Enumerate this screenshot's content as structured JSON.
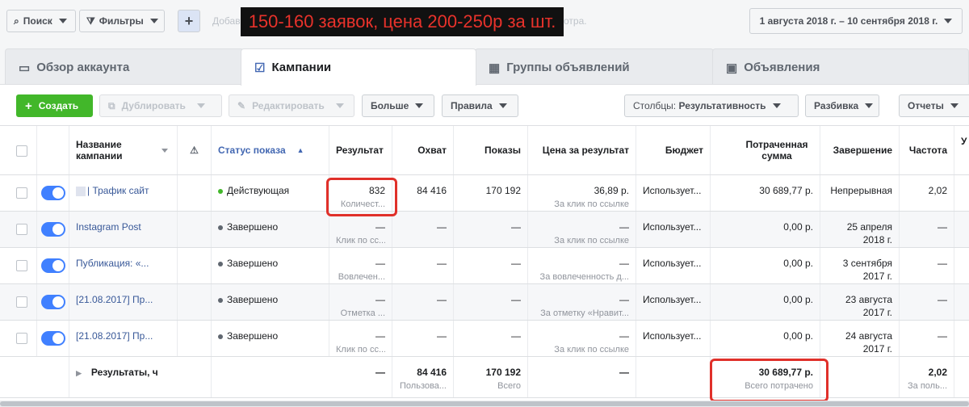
{
  "topbar": {
    "search_label": "Поиск",
    "filters_label": "Фильтры",
    "add_hint_left": "Добав",
    "add_hint_right": "отра.",
    "date_range": "1 августа 2018 г. – 10 сентября 2018 г."
  },
  "banner": "150-160 заявок, цена 200-250р за шт.",
  "tabs": [
    {
      "label": "Обзор аккаунта",
      "icon": "account-overview-icon"
    },
    {
      "label": "Кампании",
      "icon": "campaigns-icon"
    },
    {
      "label": "Группы объявлений",
      "icon": "ad-sets-icon"
    },
    {
      "label": "Объявления",
      "icon": "ads-icon"
    }
  ],
  "toolbar": {
    "create": "Создать",
    "duplicate": "Дублировать",
    "edit": "Редактировать",
    "more": "Больше",
    "rules": "Правила",
    "columns_prefix": "Столбцы: ",
    "columns_value": "Результативность",
    "breakdown": "Разбивка",
    "reports": "Отчеты"
  },
  "headers": {
    "name": "Название кампании",
    "warning": "⚠",
    "status": "Статус показа",
    "result": "Результат",
    "reach": "Охват",
    "impressions": "Показы",
    "cost_per_result": "Цена за результат",
    "budget": "Бюджет",
    "spent": "Потраченная сумма",
    "end": "Завершение",
    "frequency": "Частота",
    "extra": "У"
  },
  "rows": [
    {
      "name": "| Трафик сайт",
      "status": "Действующая",
      "status_color": "#42b72a",
      "result": "832",
      "result_sub": "Количест...",
      "reach": "84 416",
      "impressions": "170 192",
      "cpr": "36,89 р.",
      "cpr_sub": "За клик по ссылке",
      "budget": "Использует...",
      "spent": "30 689,77 р.",
      "end": "Непрерывная",
      "end2": "",
      "frequency": "2,02"
    },
    {
      "name": "Instagram Post",
      "status": "Завершено",
      "status_color": "#606770",
      "result": "—",
      "result_sub": "Клик по сс...",
      "reach": "—",
      "impressions": "—",
      "cpr": "—",
      "cpr_sub": "За клик по ссылке",
      "budget": "Использует...",
      "spent": "0,00 р.",
      "end": "25 апреля",
      "end2": "2018 г.",
      "frequency": "—"
    },
    {
      "name": "Публикация: «...",
      "status": "Завершено",
      "status_color": "#606770",
      "result": "—",
      "result_sub": "Вовлечен...",
      "reach": "—",
      "impressions": "—",
      "cpr": "—",
      "cpr_sub": "За вовлеченность д...",
      "budget": "Использует...",
      "spent": "0,00 р.",
      "end": "3 сентября",
      "end2": "2017 г.",
      "frequency": "—"
    },
    {
      "name": "[21.08.2017] Пр...",
      "status": "Завершено",
      "status_color": "#606770",
      "result": "—",
      "result_sub": "Отметка ...",
      "reach": "—",
      "impressions": "—",
      "cpr": "—",
      "cpr_sub": "За отметку «Нравит...",
      "budget": "Использует...",
      "spent": "0,00 р.",
      "end": "23 августа",
      "end2": "2017 г.",
      "frequency": "—"
    },
    {
      "name": "[21.08.2017] Пр...",
      "status": "Завершено",
      "status_color": "#606770",
      "result": "—",
      "result_sub": "Клик по сс...",
      "reach": "—",
      "impressions": "—",
      "cpr": "—",
      "cpr_sub": "За клик по ссылке",
      "budget": "Использует...",
      "spent": "0,00 р.",
      "end": "24 августа",
      "end2": "2017 г.",
      "frequency": "—"
    }
  ],
  "totals": {
    "label": "Результаты, ч",
    "result": "—",
    "reach": "84 416",
    "reach_sub": "Пользова...",
    "impressions": "170 192",
    "impressions_sub": "Всего",
    "cpr": "—",
    "spent": "30 689,77 р.",
    "spent_sub": "Всего потрачено",
    "frequency": "2,02",
    "frequency_sub": "За поль..."
  }
}
